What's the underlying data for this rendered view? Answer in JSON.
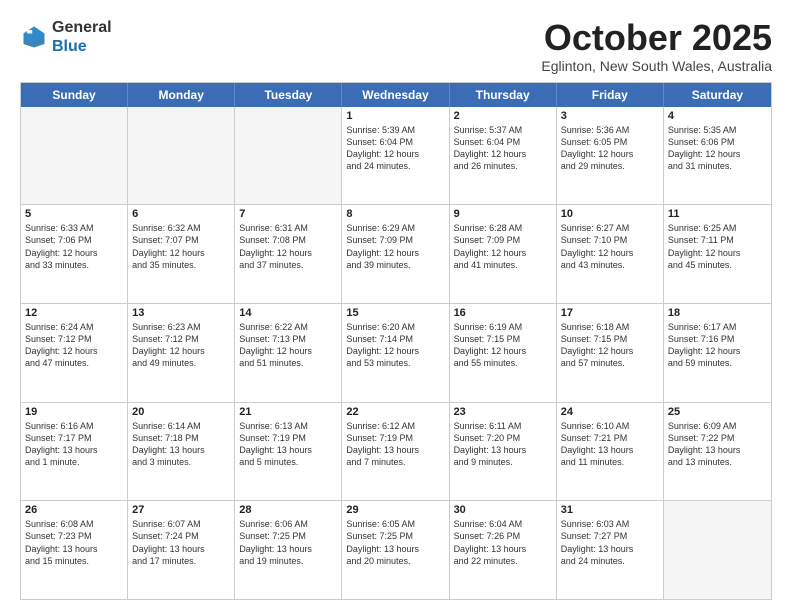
{
  "header": {
    "logo_general": "General",
    "logo_blue": "Blue",
    "month_title": "October 2025",
    "location": "Eglinton, New South Wales, Australia"
  },
  "days_of_week": [
    "Sunday",
    "Monday",
    "Tuesday",
    "Wednesday",
    "Thursday",
    "Friday",
    "Saturday"
  ],
  "weeks": [
    [
      {
        "day": "",
        "empty": true,
        "lines": []
      },
      {
        "day": "",
        "empty": true,
        "lines": []
      },
      {
        "day": "",
        "empty": true,
        "lines": []
      },
      {
        "day": "1",
        "empty": false,
        "lines": [
          "Sunrise: 5:39 AM",
          "Sunset: 6:04 PM",
          "Daylight: 12 hours",
          "and 24 minutes."
        ]
      },
      {
        "day": "2",
        "empty": false,
        "lines": [
          "Sunrise: 5:37 AM",
          "Sunset: 6:04 PM",
          "Daylight: 12 hours",
          "and 26 minutes."
        ]
      },
      {
        "day": "3",
        "empty": false,
        "lines": [
          "Sunrise: 5:36 AM",
          "Sunset: 6:05 PM",
          "Daylight: 12 hours",
          "and 29 minutes."
        ]
      },
      {
        "day": "4",
        "empty": false,
        "lines": [
          "Sunrise: 5:35 AM",
          "Sunset: 6:06 PM",
          "Daylight: 12 hours",
          "and 31 minutes."
        ]
      }
    ],
    [
      {
        "day": "5",
        "empty": false,
        "lines": [
          "Sunrise: 6:33 AM",
          "Sunset: 7:06 PM",
          "Daylight: 12 hours",
          "and 33 minutes."
        ]
      },
      {
        "day": "6",
        "empty": false,
        "lines": [
          "Sunrise: 6:32 AM",
          "Sunset: 7:07 PM",
          "Daylight: 12 hours",
          "and 35 minutes."
        ]
      },
      {
        "day": "7",
        "empty": false,
        "lines": [
          "Sunrise: 6:31 AM",
          "Sunset: 7:08 PM",
          "Daylight: 12 hours",
          "and 37 minutes."
        ]
      },
      {
        "day": "8",
        "empty": false,
        "lines": [
          "Sunrise: 6:29 AM",
          "Sunset: 7:09 PM",
          "Daylight: 12 hours",
          "and 39 minutes."
        ]
      },
      {
        "day": "9",
        "empty": false,
        "lines": [
          "Sunrise: 6:28 AM",
          "Sunset: 7:09 PM",
          "Daylight: 12 hours",
          "and 41 minutes."
        ]
      },
      {
        "day": "10",
        "empty": false,
        "lines": [
          "Sunrise: 6:27 AM",
          "Sunset: 7:10 PM",
          "Daylight: 12 hours",
          "and 43 minutes."
        ]
      },
      {
        "day": "11",
        "empty": false,
        "lines": [
          "Sunrise: 6:25 AM",
          "Sunset: 7:11 PM",
          "Daylight: 12 hours",
          "and 45 minutes."
        ]
      }
    ],
    [
      {
        "day": "12",
        "empty": false,
        "lines": [
          "Sunrise: 6:24 AM",
          "Sunset: 7:12 PM",
          "Daylight: 12 hours",
          "and 47 minutes."
        ]
      },
      {
        "day": "13",
        "empty": false,
        "lines": [
          "Sunrise: 6:23 AM",
          "Sunset: 7:12 PM",
          "Daylight: 12 hours",
          "and 49 minutes."
        ]
      },
      {
        "day": "14",
        "empty": false,
        "lines": [
          "Sunrise: 6:22 AM",
          "Sunset: 7:13 PM",
          "Daylight: 12 hours",
          "and 51 minutes."
        ]
      },
      {
        "day": "15",
        "empty": false,
        "lines": [
          "Sunrise: 6:20 AM",
          "Sunset: 7:14 PM",
          "Daylight: 12 hours",
          "and 53 minutes."
        ]
      },
      {
        "day": "16",
        "empty": false,
        "lines": [
          "Sunrise: 6:19 AM",
          "Sunset: 7:15 PM",
          "Daylight: 12 hours",
          "and 55 minutes."
        ]
      },
      {
        "day": "17",
        "empty": false,
        "lines": [
          "Sunrise: 6:18 AM",
          "Sunset: 7:15 PM",
          "Daylight: 12 hours",
          "and 57 minutes."
        ]
      },
      {
        "day": "18",
        "empty": false,
        "lines": [
          "Sunrise: 6:17 AM",
          "Sunset: 7:16 PM",
          "Daylight: 12 hours",
          "and 59 minutes."
        ]
      }
    ],
    [
      {
        "day": "19",
        "empty": false,
        "lines": [
          "Sunrise: 6:16 AM",
          "Sunset: 7:17 PM",
          "Daylight: 13 hours",
          "and 1 minute."
        ]
      },
      {
        "day": "20",
        "empty": false,
        "lines": [
          "Sunrise: 6:14 AM",
          "Sunset: 7:18 PM",
          "Daylight: 13 hours",
          "and 3 minutes."
        ]
      },
      {
        "day": "21",
        "empty": false,
        "lines": [
          "Sunrise: 6:13 AM",
          "Sunset: 7:19 PM",
          "Daylight: 13 hours",
          "and 5 minutes."
        ]
      },
      {
        "day": "22",
        "empty": false,
        "lines": [
          "Sunrise: 6:12 AM",
          "Sunset: 7:19 PM",
          "Daylight: 13 hours",
          "and 7 minutes."
        ]
      },
      {
        "day": "23",
        "empty": false,
        "lines": [
          "Sunrise: 6:11 AM",
          "Sunset: 7:20 PM",
          "Daylight: 13 hours",
          "and 9 minutes."
        ]
      },
      {
        "day": "24",
        "empty": false,
        "lines": [
          "Sunrise: 6:10 AM",
          "Sunset: 7:21 PM",
          "Daylight: 13 hours",
          "and 11 minutes."
        ]
      },
      {
        "day": "25",
        "empty": false,
        "lines": [
          "Sunrise: 6:09 AM",
          "Sunset: 7:22 PM",
          "Daylight: 13 hours",
          "and 13 minutes."
        ]
      }
    ],
    [
      {
        "day": "26",
        "empty": false,
        "lines": [
          "Sunrise: 6:08 AM",
          "Sunset: 7:23 PM",
          "Daylight: 13 hours",
          "and 15 minutes."
        ]
      },
      {
        "day": "27",
        "empty": false,
        "lines": [
          "Sunrise: 6:07 AM",
          "Sunset: 7:24 PM",
          "Daylight: 13 hours",
          "and 17 minutes."
        ]
      },
      {
        "day": "28",
        "empty": false,
        "lines": [
          "Sunrise: 6:06 AM",
          "Sunset: 7:25 PM",
          "Daylight: 13 hours",
          "and 19 minutes."
        ]
      },
      {
        "day": "29",
        "empty": false,
        "lines": [
          "Sunrise: 6:05 AM",
          "Sunset: 7:25 PM",
          "Daylight: 13 hours",
          "and 20 minutes."
        ]
      },
      {
        "day": "30",
        "empty": false,
        "lines": [
          "Sunrise: 6:04 AM",
          "Sunset: 7:26 PM",
          "Daylight: 13 hours",
          "and 22 minutes."
        ]
      },
      {
        "day": "31",
        "empty": false,
        "lines": [
          "Sunrise: 6:03 AM",
          "Sunset: 7:27 PM",
          "Daylight: 13 hours",
          "and 24 minutes."
        ]
      },
      {
        "day": "",
        "empty": true,
        "lines": []
      }
    ]
  ]
}
